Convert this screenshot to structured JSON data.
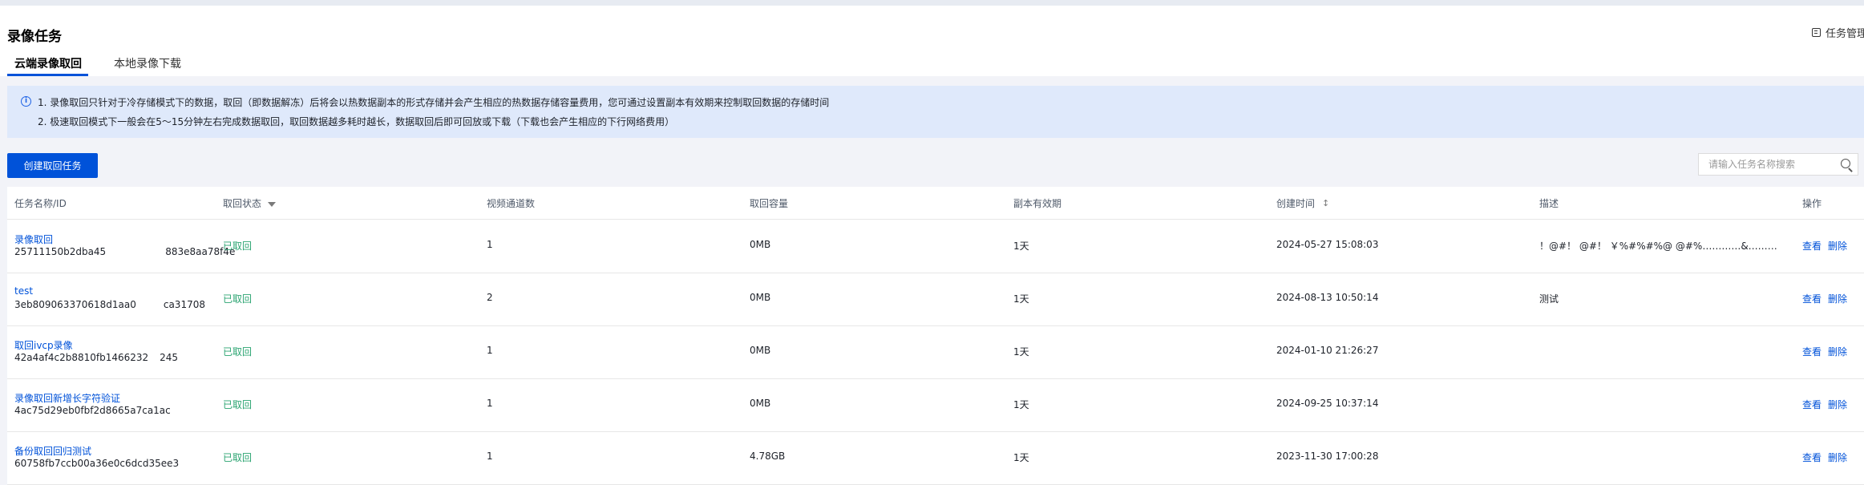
{
  "page": {
    "title": "录像任务",
    "task_manage": "任务管理"
  },
  "tabs": [
    {
      "label": "云端录像取回",
      "active": true
    },
    {
      "label": "本地录像下载",
      "active": false
    }
  ],
  "notice": {
    "icon": "info-icon",
    "line1": "1. 录像取回只针对于冷存储模式下的数据，取回（即数据解冻）后将会以热数据副本的形式存储并会产生相应的热数据存储容量费用，您可通过设置副本有效期来控制取回数据的存储时间",
    "line2": "2. 极速取回模式下一般会在5～15分钟左右完成数据取回，取回数据越多耗时越长，数据取回后即可回放或下载（下载也会产生相应的下行网络费用）"
  },
  "toolbar": {
    "create_label": "创建取回任务",
    "search_placeholder": "请输入任务名称搜索"
  },
  "table": {
    "columns": [
      "任务名称/ID",
      "取回状态",
      "视频通道数",
      "取回容量",
      "副本有效期",
      "创建时间",
      "描述",
      "操作"
    ],
    "rows": [
      {
        "name": "录像取回",
        "id": "25711150b2dba45",
        "id_tail": "883e8aa78f4e",
        "status": "已取回",
        "channels": "1",
        "capacity": "0MB",
        "validity": "1天",
        "created": "2024-05-27 15:08:03",
        "desc": "！@#！ @#！ ￥%#%#%@ @#%…………&……&#@#！ …",
        "view": "查看",
        "delete": "删除"
      },
      {
        "name": "test",
        "id": "3eb809063370618d1aa0",
        "id_tail": "ca31708",
        "status": "已取回",
        "channels": "2",
        "capacity": "0MB",
        "validity": "1天",
        "created": "2024-08-13 10:50:14",
        "desc": "测试",
        "view": "查看",
        "delete": "删除"
      },
      {
        "name": "取回ivcp录像",
        "id": "42a4af4c2b8810fb1466232",
        "id_tail": "245",
        "status": "已取回",
        "channels": "1",
        "capacity": "0MB",
        "validity": "1天",
        "created": "2024-01-10 21:26:27",
        "desc": "",
        "view": "查看",
        "delete": "删除"
      },
      {
        "name": "录像取回新增长字符验证",
        "id": "4ac75d29eb0fbf2d8665a7ca1ac",
        "id_tail": "",
        "status": "已取回",
        "channels": "1",
        "capacity": "0MB",
        "validity": "1天",
        "created": "2024-09-25 10:37:14",
        "desc": "",
        "view": "查看",
        "delete": "删除"
      },
      {
        "name": "备份取回回归测试",
        "id": "60758fb7ccb00a36e0c6dcd35ee3",
        "id_tail": "",
        "status": "已取回",
        "channels": "1",
        "capacity": "4.78GB",
        "validity": "1天",
        "created": "2023-11-30 17:00:28",
        "desc": "",
        "view": "查看",
        "delete": "删除"
      }
    ]
  },
  "colors": {
    "primary": "#0052d9",
    "success": "#2ba471",
    "notice_bg": "#dfe9fb"
  }
}
